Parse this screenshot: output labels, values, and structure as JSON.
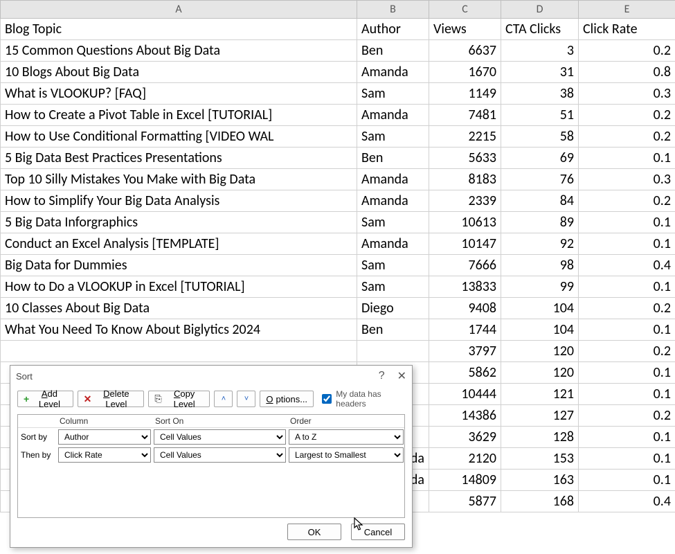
{
  "columns": [
    "A",
    "B",
    "C",
    "D",
    "E"
  ],
  "header": {
    "topic": "Blog Topic",
    "author": "Author",
    "views": "Views",
    "cta": "CTA Clicks",
    "rate": "Click Rate"
  },
  "rows": [
    {
      "topic": "15 Common Questions About Big Data",
      "author": "Ben",
      "views": "6637",
      "cta": "3",
      "rate": "0.2"
    },
    {
      "topic": "10 Blogs About Big Data",
      "author": "Amanda",
      "views": "1670",
      "cta": "31",
      "rate": "0.8"
    },
    {
      "topic": "What is VLOOKUP? [FAQ]",
      "author": "Sam",
      "views": "1149",
      "cta": "38",
      "rate": "0.3"
    },
    {
      "topic": "How to Create a Pivot Table in Excel [TUTORIAL]",
      "author": "Amanda",
      "views": "7481",
      "cta": "51",
      "rate": "0.2"
    },
    {
      "topic": "How to Use Conditional Formatting [VIDEO WAL",
      "author": "Sam",
      "views": "2215",
      "cta": "58",
      "rate": "0.2"
    },
    {
      "topic": "5 Big Data Best Practices Presentations",
      "author": "Ben",
      "views": "5633",
      "cta": "69",
      "rate": "0.1"
    },
    {
      "topic": "Top 10 Silly Mistakes You Make with Big Data",
      "author": "Amanda",
      "views": "8183",
      "cta": "76",
      "rate": "0.3"
    },
    {
      "topic": "How to Simplify Your Big Data Analysis",
      "author": "Amanda",
      "views": "2339",
      "cta": "84",
      "rate": "0.2"
    },
    {
      "topic": "5 Big Data Inforgraphics",
      "author": "Sam",
      "views": "10613",
      "cta": "89",
      "rate": "0.1"
    },
    {
      "topic": "Conduct an Excel Analysis [TEMPLATE]",
      "author": "Amanda",
      "views": "10147",
      "cta": "92",
      "rate": "0.1"
    },
    {
      "topic": "Big Data for Dummies",
      "author": "Sam",
      "views": "7666",
      "cta": "98",
      "rate": "0.4"
    },
    {
      "topic": "How to Do a VLOOKUP in Excel [TUTORIAL]",
      "author": "Sam",
      "views": "13833",
      "cta": "99",
      "rate": "0.1"
    },
    {
      "topic": "10 Classes About Big Data",
      "author": "Diego",
      "views": "9408",
      "cta": "104",
      "rate": "0.2"
    },
    {
      "topic": "What You Need To Know About Biglytics 2024",
      "author": "Ben",
      "views": "1744",
      "cta": "104",
      "rate": "0.1"
    },
    {
      "topic": "",
      "author": "",
      "views": "3797",
      "cta": "120",
      "rate": "0.2"
    },
    {
      "topic": "",
      "author": "",
      "views": "5862",
      "cta": "120",
      "rate": "0.1"
    },
    {
      "topic": "",
      "author": "",
      "views": "10444",
      "cta": "121",
      "rate": "0.1"
    },
    {
      "topic": "",
      "author": "",
      "views": "14386",
      "cta": "127",
      "rate": "0.2"
    },
    {
      "topic": "",
      "author": "",
      "views": "3629",
      "cta": "128",
      "rate": "0.1"
    },
    {
      "topic": "",
      "author": "da",
      "views": "2120",
      "cta": "153",
      "rate": "0.1"
    },
    {
      "topic": "",
      "author": "da",
      "views": "14809",
      "cta": "163",
      "rate": "0.1"
    },
    {
      "topic": "",
      "author": "",
      "views": "5877",
      "cta": "168",
      "rate": "0.4"
    }
  ],
  "dialog": {
    "title": "Sort",
    "help": "?",
    "close": "✕",
    "addLevel": "Add Level",
    "deleteLevel": "Delete Level",
    "copyLevel": "Copy Level",
    "options": "Options...",
    "headersLabel": "My data has headers",
    "colHead": "Column",
    "sortOnHead": "Sort On",
    "orderHead": "Order",
    "r1label": "Sort by",
    "r2label": "Then by",
    "r1col": "Author",
    "r1on": "Cell Values",
    "r1order": "A to Z",
    "r2col": "Click Rate",
    "r2on": "Cell Values",
    "r2order": "Largest to Smallest",
    "ok": "OK",
    "cancel": "Cancel"
  }
}
